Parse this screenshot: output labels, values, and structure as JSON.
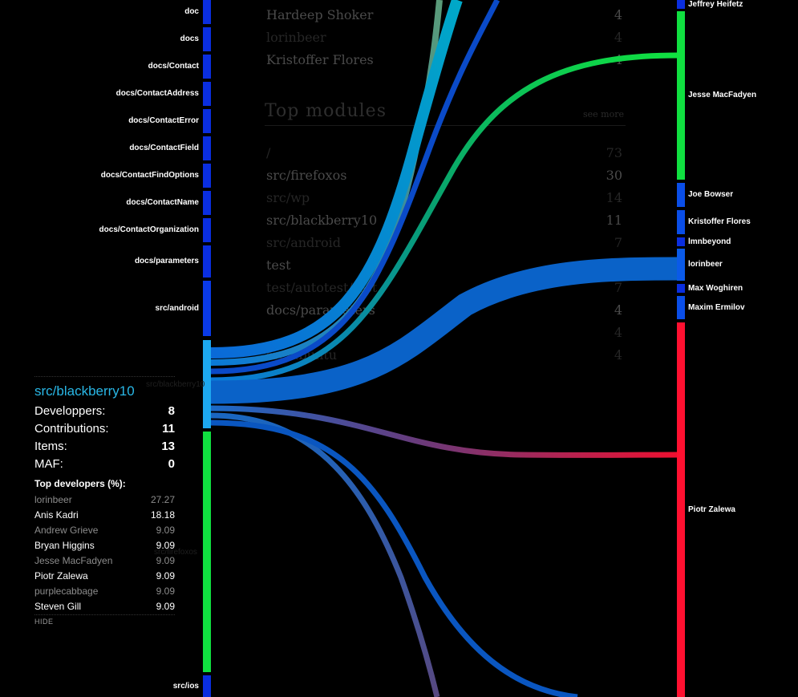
{
  "colors": {
    "background": "#000000",
    "node_blue": "#0a2ee0",
    "node_green": "#10e040",
    "node_red": "#ff1030",
    "selected_node": "#1da8f0",
    "accent_title": "#29b7e6"
  },
  "background_panel": {
    "top_developers_rows": [
      {
        "name": "Hardeep Shoker",
        "value": "4",
        "dim": false
      },
      {
        "name": "lorinbeer",
        "value": "4",
        "dim": true
      },
      {
        "name": "Kristoffer Flores",
        "value": "4",
        "dim": false
      }
    ],
    "top_modules_title": "Top modules",
    "see_more": "see more",
    "top_modules_rows": [
      {
        "name": "/",
        "value": "73",
        "dim": true
      },
      {
        "name": "src/firefoxos",
        "value": "30",
        "dim": false
      },
      {
        "name": "src/wp",
        "value": "14",
        "dim": true
      },
      {
        "name": "src/blackberry10",
        "value": "11",
        "dim": false
      },
      {
        "name": "src/android",
        "value": "7",
        "dim": true
      },
      {
        "name": "test",
        "value": "7",
        "dim": false
      },
      {
        "name": "test/autotest/test",
        "value": "7",
        "dim": true
      },
      {
        "name": "docs/parameters",
        "value": "4",
        "dim": false
      },
      {
        "name": "",
        "value": "4",
        "dim": true
      },
      {
        "name": "src/ubuntu",
        "value": "4",
        "dim": true
      }
    ]
  },
  "left_nodes": [
    {
      "label": "doc",
      "color": "#0a2ee0"
    },
    {
      "label": "docs",
      "color": "#0a2ee0"
    },
    {
      "label": "docs/Contact",
      "color": "#0a2ee0"
    },
    {
      "label": "docs/ContactAddress",
      "color": "#0a2ee0"
    },
    {
      "label": "docs/ContactError",
      "color": "#0a2ee0"
    },
    {
      "label": "docs/ContactField",
      "color": "#0a2ee0"
    },
    {
      "label": "docs/ContactFindOptions",
      "color": "#0a2ee0"
    },
    {
      "label": "docs/ContactName",
      "color": "#0a2ee0"
    },
    {
      "label": "docs/ContactOrganization",
      "color": "#0a2ee0"
    },
    {
      "label": "docs/parameters",
      "color": "#0a2ee0"
    },
    {
      "label": "src/android",
      "color": "#0a3ae8"
    },
    {
      "label": "src/blackberry10",
      "color": "#1da8f0"
    },
    {
      "label": "src/firefoxos",
      "color": "#10e040"
    },
    {
      "label": "src/ios",
      "color": "#0a2ee0"
    }
  ],
  "right_nodes": [
    {
      "label": "Jeffrey Heifetz",
      "color": "#0a2ee0"
    },
    {
      "label": "Jesse MacFadyen",
      "color": "#10e040"
    },
    {
      "label": "Joe Bowser",
      "color": "#0a4ee8"
    },
    {
      "label": "Kristoffer Flores",
      "color": "#0a4ee8"
    },
    {
      "label": "lmnbeyond",
      "color": "#0a2ee0"
    },
    {
      "label": "lorinbeer",
      "color": "#0a5ae8"
    },
    {
      "label": "Max Woghiren",
      "color": "#0a2ee0"
    },
    {
      "label": "Maxim Ermilov",
      "color": "#0a4ee8"
    },
    {
      "label": "Piotr Zalewa",
      "color": "#ff1030"
    }
  ],
  "info_panel": {
    "title": "src/blackberry10",
    "stats": [
      {
        "label": "Developpers:",
        "value": "8"
      },
      {
        "label": "Contributions:",
        "value": "11"
      },
      {
        "label": "Items:",
        "value": "13"
      },
      {
        "label": "MAF:",
        "value": "0"
      }
    ],
    "top_devs_heading": "Top developers (%):",
    "top_devs": [
      {
        "name": "lorinbeer",
        "value": "27.27",
        "dim": true
      },
      {
        "name": "Anis Kadri",
        "value": "18.18",
        "dim": false
      },
      {
        "name": "Andrew Grieve",
        "value": "9.09",
        "dim": true
      },
      {
        "name": "Bryan Higgins",
        "value": "9.09",
        "dim": false
      },
      {
        "name": "Jesse MacFadyen",
        "value": "9.09",
        "dim": true
      },
      {
        "name": "Piotr Zalewa",
        "value": "9.09",
        "dim": false
      },
      {
        "name": "purplecabbage",
        "value": "9.09",
        "dim": true
      },
      {
        "name": "Steven Gill",
        "value": "9.09",
        "dim": false
      }
    ],
    "hide_label": "HIDE"
  }
}
